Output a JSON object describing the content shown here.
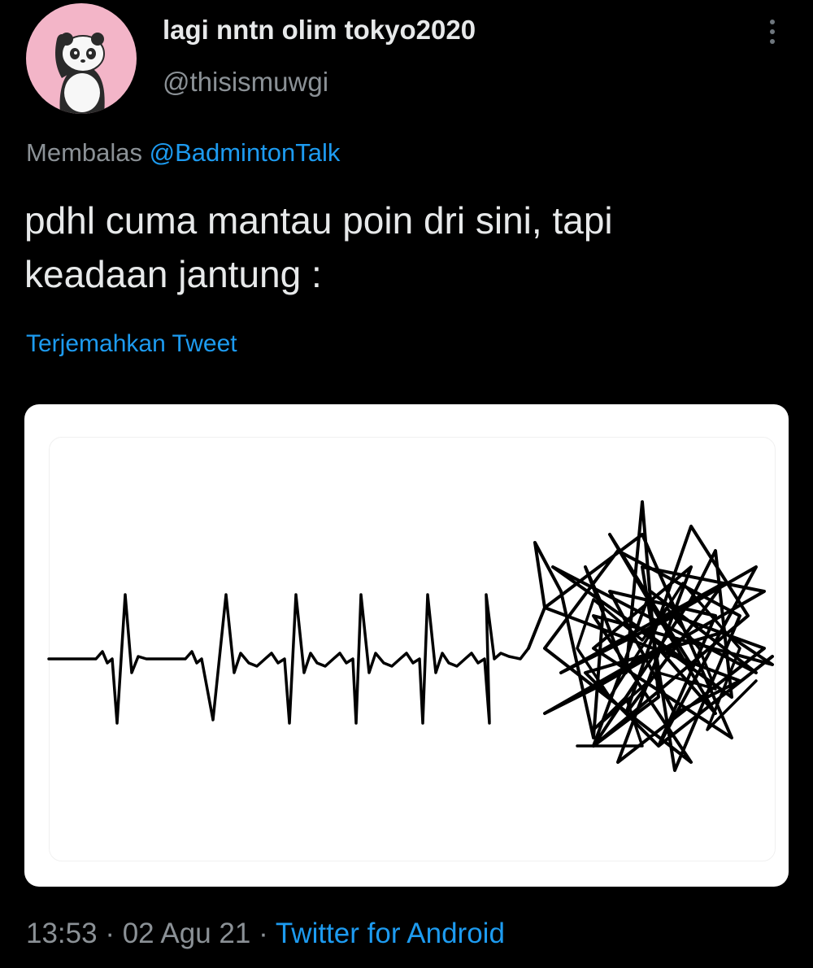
{
  "header": {
    "display_name": "lagi nntn olim tokyo2020",
    "handle": "@thisismuwgi",
    "avatar_icon": "panda-avatar-icon",
    "more_icon": "more-vertical-icon"
  },
  "reply": {
    "prefix": "Membalas ",
    "mention": "@BadmintonTalk"
  },
  "tweet": {
    "line1": "pdhl cuma mantau poin dri sini, tapi",
    "line2": "keadaan jantung :"
  },
  "translate_label": "Terjemahkan Tweet",
  "media": {
    "description_icon": "heartbeat-scribble-image"
  },
  "meta": {
    "time": "13:53",
    "sep1": " · ",
    "date": "02 Agu 21",
    "sep2": " · ",
    "source": "Twitter for Android"
  },
  "colors": {
    "background": "#000000",
    "text": "#e7e9ea",
    "muted": "#8b9196",
    "link": "#1d9bf0",
    "avatar_bg": "#f3b5c8"
  }
}
